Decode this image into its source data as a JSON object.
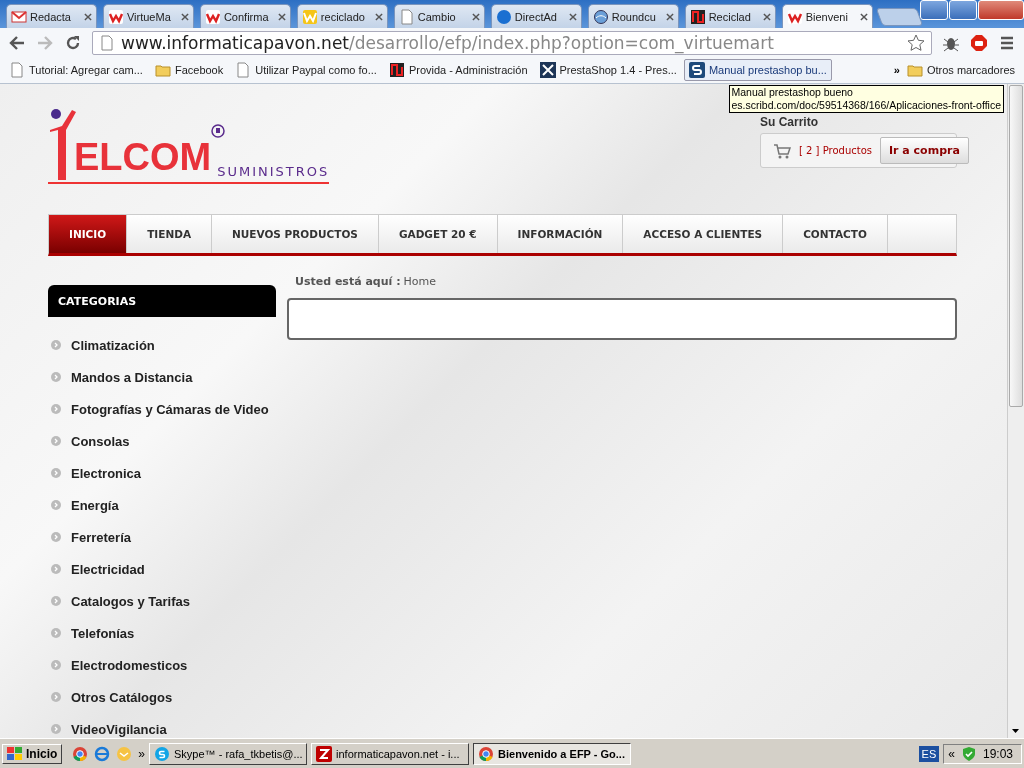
{
  "browser": {
    "tabs": [
      {
        "title": "Redacta",
        "kind": "mail",
        "selected": false
      },
      {
        "title": "VirtueMa",
        "kind": "w-red",
        "selected": false
      },
      {
        "title": "Confirma",
        "kind": "w-red",
        "selected": false
      },
      {
        "title": "reciclado",
        "kind": "w-yellow",
        "selected": false
      },
      {
        "title": "Cambio",
        "kind": "page",
        "selected": false
      },
      {
        "title": "DirectAd",
        "kind": "blue-dot",
        "selected": false
      },
      {
        "title": "Roundcu",
        "kind": "globe",
        "selected": false
      },
      {
        "title": "Reciclad",
        "kind": "red-frame",
        "selected": false
      },
      {
        "title": "Bienveni",
        "kind": "w-red",
        "selected": true
      }
    ],
    "address": {
      "host": "www.informaticapavon.net",
      "path": "/desarrollo/efp/index.php?option=com_virtuemart"
    },
    "bookmarks": [
      {
        "label": "Tutorial: Agregar cam...",
        "kind": "page",
        "hovered": false
      },
      {
        "label": "Facebook",
        "kind": "folder",
        "hovered": false
      },
      {
        "label": "Utilizar Paypal como fo...",
        "kind": "page",
        "hovered": false
      },
      {
        "label": "Provida - Administración",
        "kind": "red-frame",
        "hovered": false
      },
      {
        "label": "PrestaShop 1.4 - Pres...",
        "kind": "cross",
        "hovered": false
      },
      {
        "label": "Manual prestashop bu...",
        "kind": "s-blue",
        "hovered": true
      }
    ],
    "bookmarks_overflow": "»",
    "other_bookmarks": "Otros marcadores",
    "tooltip": {
      "title": "Manual prestashop bueno",
      "url": "es.scribd.com/doc/59514368/166/Aplicaciones-front-office"
    }
  },
  "page": {
    "logo": {
      "name": "ELCOM",
      "tagline": "SUMINISTROS"
    },
    "cart": {
      "title": "Su Carrito",
      "count": "[ 2 ] Productos",
      "button": "Ir a compra"
    },
    "nav": [
      {
        "label": "INICIO",
        "selected": true
      },
      {
        "label": "TIENDA",
        "selected": false
      },
      {
        "label": "NUEVOS PRODUCTOS",
        "selected": false
      },
      {
        "label": "GADGET 20 €",
        "selected": false
      },
      {
        "label": "INFORMACIÓN",
        "selected": false
      },
      {
        "label": "ACCESO A CLIENTES",
        "selected": false
      },
      {
        "label": "CONTACTO",
        "selected": false
      }
    ],
    "sidebar": {
      "title": "CATEGORIAS",
      "items": [
        "Climatización",
        "Mandos a Distancia",
        "Fotografías y Cámaras de Video",
        "Consolas",
        "Electronica",
        "Energía",
        "Ferretería",
        "Electricidad",
        "Catalogos y Tarifas",
        "Telefonías",
        "Electrodomesticos",
        "Otros Catálogos",
        "VideoVigilancia"
      ]
    },
    "breadcrumb": {
      "label": "Usted está aquí :",
      "current": "Home"
    }
  },
  "taskbar": {
    "start": "Inicio",
    "overflow": "»",
    "tasks": [
      {
        "label": "Skype™ - rafa_tkbetis@...",
        "kind": "skype",
        "selected": false
      },
      {
        "label": "informaticapavon.net - i...",
        "kind": "filezilla",
        "selected": false
      },
      {
        "label": "Bienvenido a EFP - Go...",
        "kind": "chrome",
        "selected": true
      }
    ],
    "language": "ES",
    "tray_toggle": "«",
    "clock": "19:03"
  }
}
